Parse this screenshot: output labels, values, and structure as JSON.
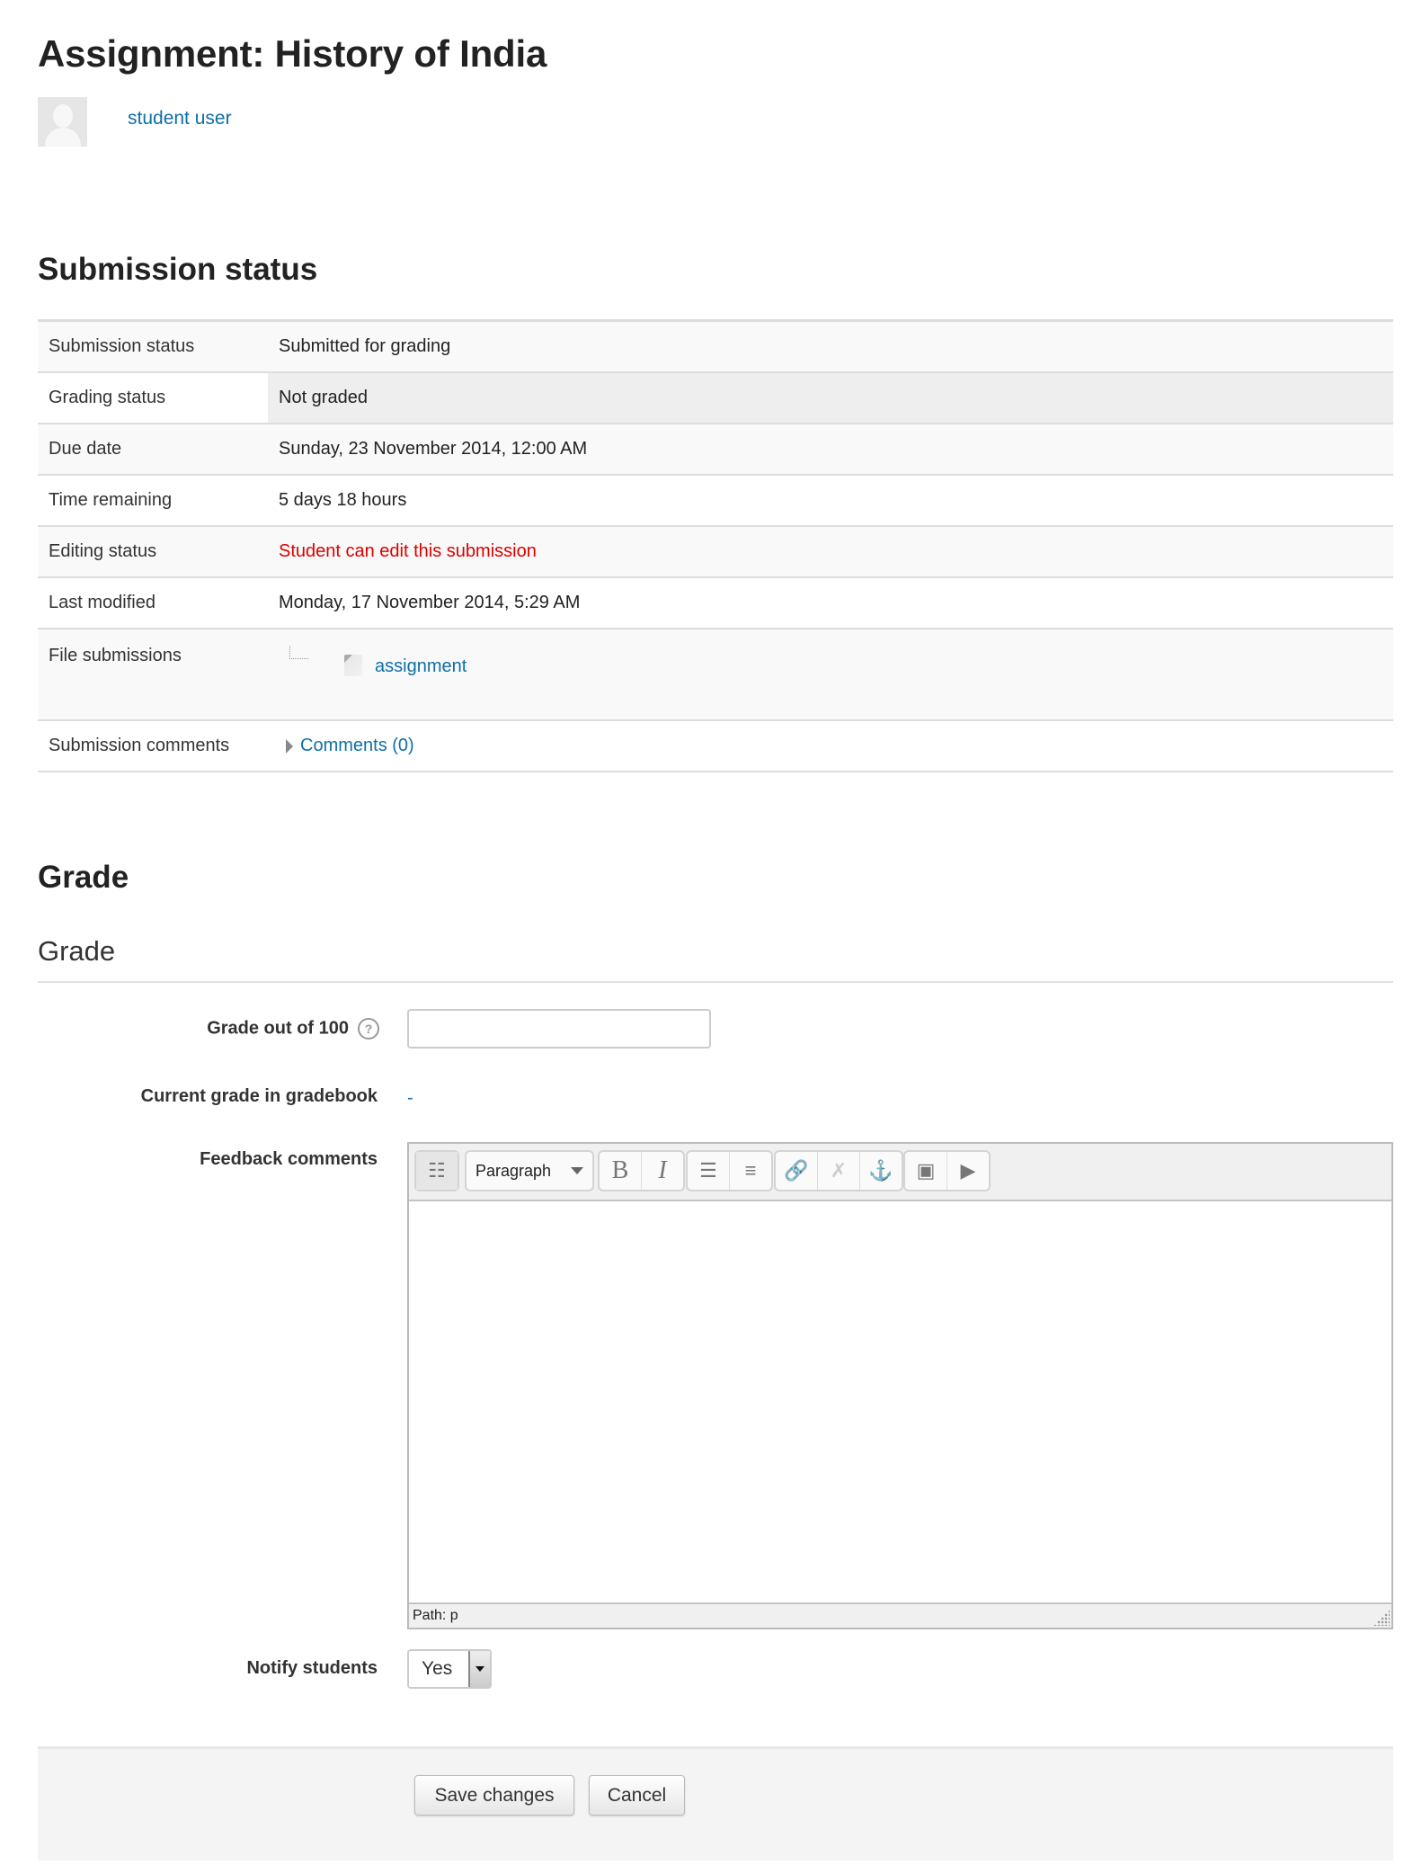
{
  "page": {
    "title": "Assignment: History of India",
    "user_name": "student user"
  },
  "submission": {
    "heading": "Submission status",
    "rows": [
      {
        "label": "Submission status",
        "value": "Submitted for grading"
      },
      {
        "label": "Grading status",
        "value": "Not graded"
      },
      {
        "label": "Due date",
        "value": "Sunday, 23 November 2014, 12:00 AM"
      },
      {
        "label": "Time remaining",
        "value": "5 days 18 hours"
      },
      {
        "label": "Editing status",
        "value": "Student can edit this submission"
      },
      {
        "label": "Last modified",
        "value": "Monday, 17 November 2014, 5:29 AM"
      },
      {
        "label": "File submissions",
        "value": "assignment"
      },
      {
        "label": "Submission comments",
        "value": "Comments (0)"
      }
    ],
    "editing_status_color": "#dd0000"
  },
  "grade": {
    "heading": "Grade",
    "subheading": "Grade",
    "grade_label": "Grade out of 100",
    "grade_value": "",
    "help_icon": "?",
    "current_label": "Current grade in gradebook",
    "current_value": "-",
    "feedback_label": "Feedback comments",
    "editor": {
      "format": "Paragraph",
      "bold": "B",
      "italic": "I",
      "path": "Path: p"
    },
    "notify_label": "Notify students",
    "notify_value": "Yes"
  },
  "actions": {
    "save": "Save changes",
    "cancel": "Cancel"
  },
  "colors": {
    "link": "#0f6fa6",
    "warning": "#dd0000"
  }
}
